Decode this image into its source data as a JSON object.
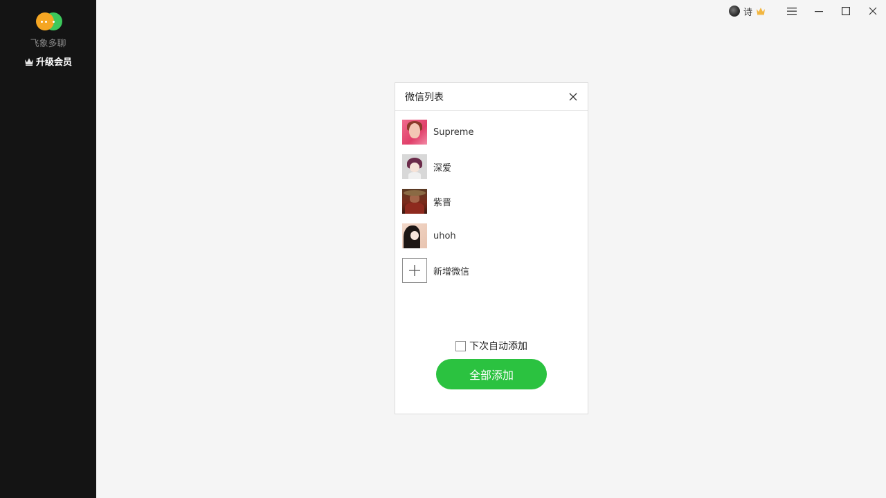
{
  "sidebar": {
    "app_name": "飞象多聊",
    "upgrade_label": "升级会员"
  },
  "topbar": {
    "user_name": "诗"
  },
  "dialog": {
    "title": "微信列表",
    "accounts": [
      {
        "label": "Supreme"
      },
      {
        "label": "深爱"
      },
      {
        "label": "紫晋"
      },
      {
        "label": "uhoh"
      }
    ],
    "add_new_label": "新增微信",
    "auto_add_label": "下次自动添加",
    "auto_add_checked": false,
    "add_all_label": "全部添加"
  },
  "colors": {
    "sidebar_bg": "#141414",
    "accent_green": "#2bc240",
    "logo_orange": "#f5a623",
    "logo_green": "#3cc85b",
    "crown_gold": "#f2b640"
  },
  "icons": {
    "logo": "chat-bubbles-icon",
    "upgrade": "crown-icon",
    "vip": "gold-crown-icon",
    "menu": "hamburger-icon",
    "minimize": "minimize-icon",
    "maximize": "maximize-icon",
    "close": "close-icon",
    "add": "plus-icon"
  }
}
